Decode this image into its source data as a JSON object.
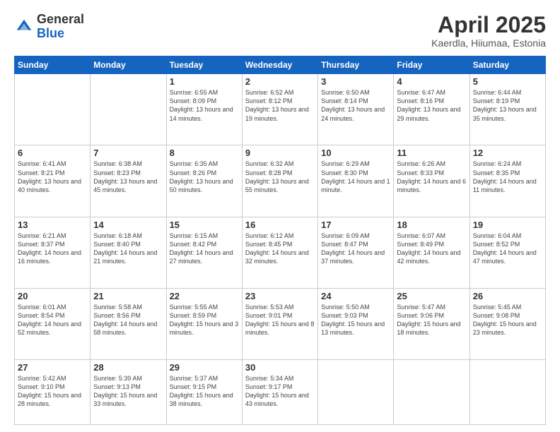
{
  "header": {
    "logo": {
      "general": "General",
      "blue": "Blue"
    },
    "title": "April 2025",
    "subtitle": "Kaerdla, Hiiumaa, Estonia"
  },
  "weekdays": [
    "Sunday",
    "Monday",
    "Tuesday",
    "Wednesday",
    "Thursday",
    "Friday",
    "Saturday"
  ],
  "weeks": [
    [
      {
        "day": null,
        "sunrise": null,
        "sunset": null,
        "daylight": null
      },
      {
        "day": null,
        "sunrise": null,
        "sunset": null,
        "daylight": null
      },
      {
        "day": "1",
        "sunrise": "Sunrise: 6:55 AM",
        "sunset": "Sunset: 8:09 PM",
        "daylight": "Daylight: 13 hours and 14 minutes."
      },
      {
        "day": "2",
        "sunrise": "Sunrise: 6:52 AM",
        "sunset": "Sunset: 8:12 PM",
        "daylight": "Daylight: 13 hours and 19 minutes."
      },
      {
        "day": "3",
        "sunrise": "Sunrise: 6:50 AM",
        "sunset": "Sunset: 8:14 PM",
        "daylight": "Daylight: 13 hours and 24 minutes."
      },
      {
        "day": "4",
        "sunrise": "Sunrise: 6:47 AM",
        "sunset": "Sunset: 8:16 PM",
        "daylight": "Daylight: 13 hours and 29 minutes."
      },
      {
        "day": "5",
        "sunrise": "Sunrise: 6:44 AM",
        "sunset": "Sunset: 8:19 PM",
        "daylight": "Daylight: 13 hours and 35 minutes."
      }
    ],
    [
      {
        "day": "6",
        "sunrise": "Sunrise: 6:41 AM",
        "sunset": "Sunset: 8:21 PM",
        "daylight": "Daylight: 13 hours and 40 minutes."
      },
      {
        "day": "7",
        "sunrise": "Sunrise: 6:38 AM",
        "sunset": "Sunset: 8:23 PM",
        "daylight": "Daylight: 13 hours and 45 minutes."
      },
      {
        "day": "8",
        "sunrise": "Sunrise: 6:35 AM",
        "sunset": "Sunset: 8:26 PM",
        "daylight": "Daylight: 13 hours and 50 minutes."
      },
      {
        "day": "9",
        "sunrise": "Sunrise: 6:32 AM",
        "sunset": "Sunset: 8:28 PM",
        "daylight": "Daylight: 13 hours and 55 minutes."
      },
      {
        "day": "10",
        "sunrise": "Sunrise: 6:29 AM",
        "sunset": "Sunset: 8:30 PM",
        "daylight": "Daylight: 14 hours and 1 minute."
      },
      {
        "day": "11",
        "sunrise": "Sunrise: 6:26 AM",
        "sunset": "Sunset: 8:33 PM",
        "daylight": "Daylight: 14 hours and 6 minutes."
      },
      {
        "day": "12",
        "sunrise": "Sunrise: 6:24 AM",
        "sunset": "Sunset: 8:35 PM",
        "daylight": "Daylight: 14 hours and 11 minutes."
      }
    ],
    [
      {
        "day": "13",
        "sunrise": "Sunrise: 6:21 AM",
        "sunset": "Sunset: 8:37 PM",
        "daylight": "Daylight: 14 hours and 16 minutes."
      },
      {
        "day": "14",
        "sunrise": "Sunrise: 6:18 AM",
        "sunset": "Sunset: 8:40 PM",
        "daylight": "Daylight: 14 hours and 21 minutes."
      },
      {
        "day": "15",
        "sunrise": "Sunrise: 6:15 AM",
        "sunset": "Sunset: 8:42 PM",
        "daylight": "Daylight: 14 hours and 27 minutes."
      },
      {
        "day": "16",
        "sunrise": "Sunrise: 6:12 AM",
        "sunset": "Sunset: 8:45 PM",
        "daylight": "Daylight: 14 hours and 32 minutes."
      },
      {
        "day": "17",
        "sunrise": "Sunrise: 6:09 AM",
        "sunset": "Sunset: 8:47 PM",
        "daylight": "Daylight: 14 hours and 37 minutes."
      },
      {
        "day": "18",
        "sunrise": "Sunrise: 6:07 AM",
        "sunset": "Sunset: 8:49 PM",
        "daylight": "Daylight: 14 hours and 42 minutes."
      },
      {
        "day": "19",
        "sunrise": "Sunrise: 6:04 AM",
        "sunset": "Sunset: 8:52 PM",
        "daylight": "Daylight: 14 hours and 47 minutes."
      }
    ],
    [
      {
        "day": "20",
        "sunrise": "Sunrise: 6:01 AM",
        "sunset": "Sunset: 8:54 PM",
        "daylight": "Daylight: 14 hours and 52 minutes."
      },
      {
        "day": "21",
        "sunrise": "Sunrise: 5:58 AM",
        "sunset": "Sunset: 8:56 PM",
        "daylight": "Daylight: 14 hours and 58 minutes."
      },
      {
        "day": "22",
        "sunrise": "Sunrise: 5:55 AM",
        "sunset": "Sunset: 8:59 PM",
        "daylight": "Daylight: 15 hours and 3 minutes."
      },
      {
        "day": "23",
        "sunrise": "Sunrise: 5:53 AM",
        "sunset": "Sunset: 9:01 PM",
        "daylight": "Daylight: 15 hours and 8 minutes."
      },
      {
        "day": "24",
        "sunrise": "Sunrise: 5:50 AM",
        "sunset": "Sunset: 9:03 PM",
        "daylight": "Daylight: 15 hours and 13 minutes."
      },
      {
        "day": "25",
        "sunrise": "Sunrise: 5:47 AM",
        "sunset": "Sunset: 9:06 PM",
        "daylight": "Daylight: 15 hours and 18 minutes."
      },
      {
        "day": "26",
        "sunrise": "Sunrise: 5:45 AM",
        "sunset": "Sunset: 9:08 PM",
        "daylight": "Daylight: 15 hours and 23 minutes."
      }
    ],
    [
      {
        "day": "27",
        "sunrise": "Sunrise: 5:42 AM",
        "sunset": "Sunset: 9:10 PM",
        "daylight": "Daylight: 15 hours and 28 minutes."
      },
      {
        "day": "28",
        "sunrise": "Sunrise: 5:39 AM",
        "sunset": "Sunset: 9:13 PM",
        "daylight": "Daylight: 15 hours and 33 minutes."
      },
      {
        "day": "29",
        "sunrise": "Sunrise: 5:37 AM",
        "sunset": "Sunset: 9:15 PM",
        "daylight": "Daylight: 15 hours and 38 minutes."
      },
      {
        "day": "30",
        "sunrise": "Sunrise: 5:34 AM",
        "sunset": "Sunset: 9:17 PM",
        "daylight": "Daylight: 15 hours and 43 minutes."
      },
      {
        "day": null,
        "sunrise": null,
        "sunset": null,
        "daylight": null
      },
      {
        "day": null,
        "sunrise": null,
        "sunset": null,
        "daylight": null
      },
      {
        "day": null,
        "sunrise": null,
        "sunset": null,
        "daylight": null
      }
    ]
  ]
}
